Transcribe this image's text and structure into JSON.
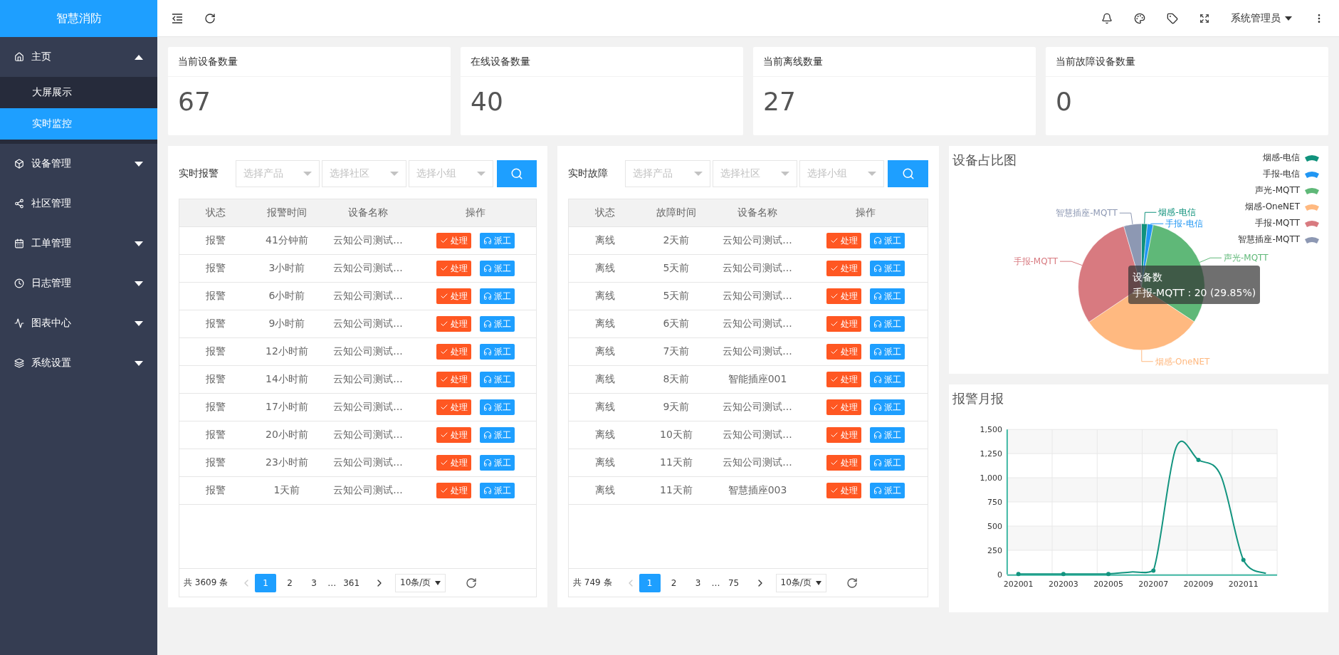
{
  "sidebar": {
    "logo": "智慧消防",
    "items": [
      {
        "label": "主页",
        "expanded": true,
        "children": [
          {
            "label": "大屏展示",
            "selected": false
          },
          {
            "label": "实时监控",
            "selected": true
          }
        ]
      },
      {
        "label": "设备管理",
        "expanded": false
      },
      {
        "label": "社区管理"
      },
      {
        "label": "工单管理",
        "expanded": false
      },
      {
        "label": "日志管理",
        "expanded": false
      },
      {
        "label": "图表中心",
        "expanded": false
      },
      {
        "label": "系统设置",
        "expanded": false
      }
    ]
  },
  "header": {
    "user": "系统管理员"
  },
  "stats": [
    {
      "title": "当前设备数量",
      "value": "67"
    },
    {
      "title": "在线设备数量",
      "value": "40"
    },
    {
      "title": "当前离线数量",
      "value": "27"
    },
    {
      "title": "当前故障设备数量",
      "value": "0"
    }
  ],
  "tables": [
    {
      "title": "实时报警",
      "filters": [
        {
          "placeholder": "选择产品"
        },
        {
          "placeholder": "选择社区"
        },
        {
          "placeholder": "选择小组"
        }
      ],
      "columns": [
        "状态",
        "报警时间",
        "设备名称",
        "操作"
      ],
      "rows": [
        {
          "status": "报警",
          "time": "41分钟前",
          "device": "云知公司测试...",
          "actions": [
            {
              "label": "处理",
              "kind": "handle"
            },
            {
              "label": "派工",
              "kind": "dispatch"
            }
          ]
        },
        {
          "status": "报警",
          "time": "3小时前",
          "device": "云知公司测试...",
          "actions": [
            {
              "label": "处理",
              "kind": "handle"
            },
            {
              "label": "派工",
              "kind": "dispatch"
            }
          ]
        },
        {
          "status": "报警",
          "time": "6小时前",
          "device": "云知公司测试...",
          "actions": [
            {
              "label": "处理",
              "kind": "handle"
            },
            {
              "label": "派工",
              "kind": "dispatch"
            }
          ]
        },
        {
          "status": "报警",
          "time": "9小时前",
          "device": "云知公司测试...",
          "actions": [
            {
              "label": "处理",
              "kind": "handle"
            },
            {
              "label": "派工",
              "kind": "dispatch"
            }
          ]
        },
        {
          "status": "报警",
          "time": "12小时前",
          "device": "云知公司测试...",
          "actions": [
            {
              "label": "处理",
              "kind": "handle"
            },
            {
              "label": "派工",
              "kind": "dispatch"
            }
          ]
        },
        {
          "status": "报警",
          "time": "14小时前",
          "device": "云知公司测试...",
          "actions": [
            {
              "label": "处理",
              "kind": "handle"
            },
            {
              "label": "派工",
              "kind": "dispatch"
            }
          ]
        },
        {
          "status": "报警",
          "time": "17小时前",
          "device": "云知公司测试...",
          "actions": [
            {
              "label": "处理",
              "kind": "handle"
            },
            {
              "label": "派工",
              "kind": "dispatch"
            }
          ]
        },
        {
          "status": "报警",
          "time": "20小时前",
          "device": "云知公司测试...",
          "actions": [
            {
              "label": "处理",
              "kind": "handle"
            },
            {
              "label": "派工",
              "kind": "dispatch"
            }
          ]
        },
        {
          "status": "报警",
          "time": "23小时前",
          "device": "云知公司测试...",
          "actions": [
            {
              "label": "处理",
              "kind": "handle"
            },
            {
              "label": "派工",
              "kind": "dispatch"
            }
          ]
        },
        {
          "status": "报警",
          "time": "1天前",
          "device": "云知公司测试...",
          "actions": [
            {
              "label": "处理",
              "kind": "handle"
            },
            {
              "label": "派工",
              "kind": "dispatch"
            }
          ]
        }
      ],
      "pagination": {
        "total": "共 3609 条",
        "prev_disabled": true,
        "next_disabled": false,
        "pages": [
          {
            "label": "1",
            "kind": "page",
            "selected": true
          },
          {
            "label": "2",
            "kind": "page",
            "selected": false
          },
          {
            "label": "3",
            "kind": "page",
            "selected": false
          },
          {
            "label": "…",
            "kind": "ellipsis"
          },
          {
            "label": "361",
            "kind": "page",
            "selected": false
          }
        ],
        "page_size": "10条/页"
      }
    },
    {
      "title": "实时故障",
      "filters": [
        {
          "placeholder": "选择产品"
        },
        {
          "placeholder": "选择社区"
        },
        {
          "placeholder": "选择小组"
        }
      ],
      "columns": [
        "状态",
        "故障时间",
        "设备名称",
        "操作"
      ],
      "rows": [
        {
          "status": "离线",
          "time": "2天前",
          "device": "云知公司测试...",
          "actions": [
            {
              "label": "处理",
              "kind": "handle"
            },
            {
              "label": "派工",
              "kind": "dispatch"
            }
          ]
        },
        {
          "status": "离线",
          "time": "5天前",
          "device": "云知公司测试...",
          "actions": [
            {
              "label": "处理",
              "kind": "handle"
            },
            {
              "label": "派工",
              "kind": "dispatch"
            }
          ]
        },
        {
          "status": "离线",
          "time": "5天前",
          "device": "云知公司测试...",
          "actions": [
            {
              "label": "处理",
              "kind": "handle"
            },
            {
              "label": "派工",
              "kind": "dispatch"
            }
          ]
        },
        {
          "status": "离线",
          "time": "6天前",
          "device": "云知公司测试...",
          "actions": [
            {
              "label": "处理",
              "kind": "handle"
            },
            {
              "label": "派工",
              "kind": "dispatch"
            }
          ]
        },
        {
          "status": "离线",
          "time": "7天前",
          "device": "云知公司测试...",
          "actions": [
            {
              "label": "处理",
              "kind": "handle"
            },
            {
              "label": "派工",
              "kind": "dispatch"
            }
          ]
        },
        {
          "status": "离线",
          "time": "8天前",
          "device": "智能插座001",
          "actions": [
            {
              "label": "处理",
              "kind": "handle"
            },
            {
              "label": "派工",
              "kind": "dispatch"
            }
          ]
        },
        {
          "status": "离线",
          "time": "9天前",
          "device": "云知公司测试...",
          "actions": [
            {
              "label": "处理",
              "kind": "handle"
            },
            {
              "label": "派工",
              "kind": "dispatch"
            }
          ]
        },
        {
          "status": "离线",
          "time": "10天前",
          "device": "云知公司测试...",
          "actions": [
            {
              "label": "处理",
              "kind": "handle"
            },
            {
              "label": "派工",
              "kind": "dispatch"
            }
          ]
        },
        {
          "status": "离线",
          "time": "11天前",
          "device": "云知公司测试...",
          "actions": [
            {
              "label": "处理",
              "kind": "handle"
            },
            {
              "label": "派工",
              "kind": "dispatch"
            }
          ]
        },
        {
          "status": "离线",
          "time": "11天前",
          "device": "智慧插座003",
          "actions": [
            {
              "label": "处理",
              "kind": "handle"
            },
            {
              "label": "派工",
              "kind": "dispatch"
            }
          ]
        }
      ],
      "pagination": {
        "total": "共 749 条",
        "prev_disabled": true,
        "next_disabled": false,
        "pages": [
          {
            "label": "1",
            "kind": "page",
            "selected": true
          },
          {
            "label": "2",
            "kind": "page",
            "selected": false
          },
          {
            "label": "3",
            "kind": "page",
            "selected": false
          },
          {
            "label": "…",
            "kind": "ellipsis"
          },
          {
            "label": "75",
            "kind": "page",
            "selected": false
          }
        ],
        "page_size": "10条/页"
      }
    }
  ],
  "pie_card": {
    "title": "设备占比图",
    "tooltip": {
      "title": "设备数",
      "text": "手报-MQTT : 20 (29.85%)"
    },
    "chart_data": {
      "type": "pie",
      "categories": [
        "烟感-电信",
        "手报-电信",
        "声光-MQTT",
        "烟感-OneNET",
        "手报-MQTT",
        "智慧插座-MQTT"
      ],
      "values": [
        1.5,
        1.5,
        31.3,
        31.3,
        29.9,
        4.5
      ],
      "colors": [
        "#10927c",
        "#2196f3",
        "#5fb878",
        "#ffb980",
        "#d87a80",
        "#8d98b3"
      ],
      "legend": true
    }
  },
  "line_card": {
    "title": "报警月报",
    "chart_data": {
      "type": "line",
      "categories": [
        "202001",
        null,
        "202003",
        null,
        "202005",
        null,
        "202007",
        null,
        "202009",
        null,
        "202011",
        null
      ],
      "series": [
        {
          "color": "#12947f",
          "values": [
            5,
            5,
            5,
            5,
            5,
            25,
            40,
            1310,
            1185,
            1020,
            150,
            10
          ]
        }
      ],
      "ylim": [
        0,
        1500
      ],
      "grid": true,
      "yticks": [
        {
          "value": 0,
          "label": "0"
        },
        {
          "value": 250,
          "label": "250"
        },
        {
          "value": 500,
          "label": "500"
        },
        {
          "value": 750,
          "label": "750"
        },
        {
          "value": 1000,
          "label": "1,000"
        },
        {
          "value": 1250,
          "label": "1,250"
        },
        {
          "value": 1500,
          "label": "1,500"
        }
      ]
    }
  }
}
